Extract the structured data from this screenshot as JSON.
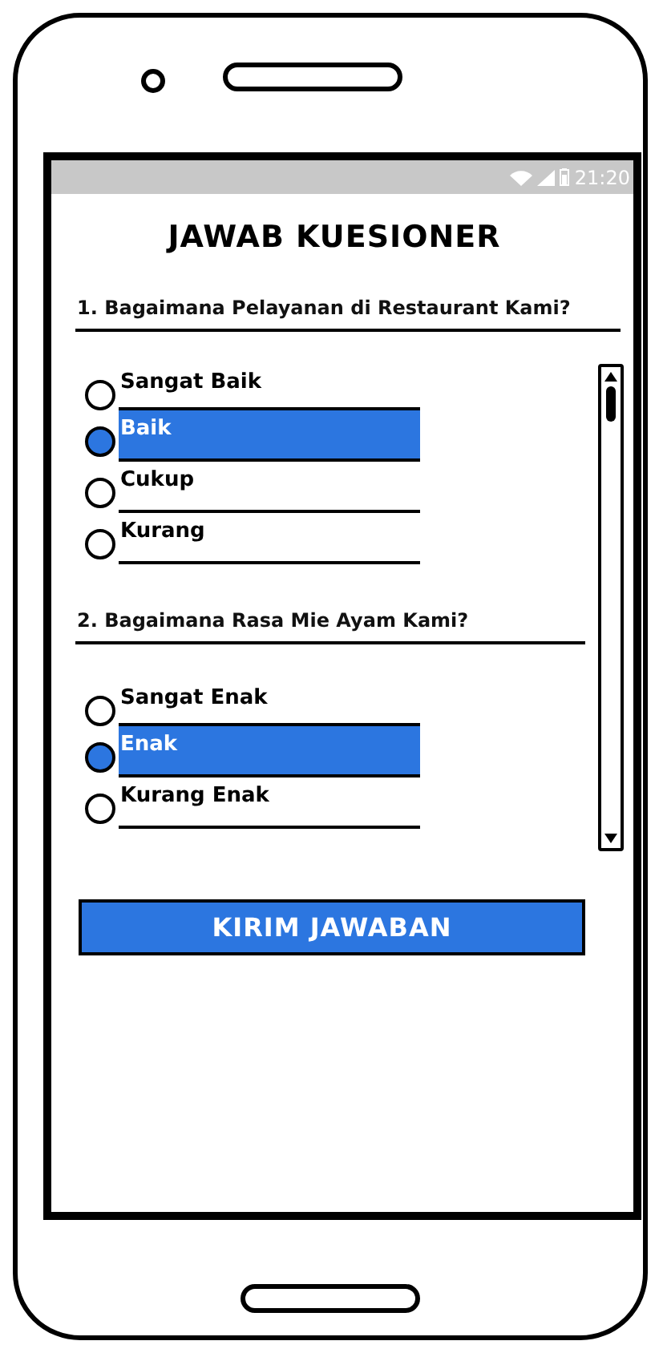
{
  "status_bar": {
    "time": "21:20"
  },
  "title": "JAWAB KUESIONER",
  "questions": [
    {
      "text": "1. Bagaimana Pelayanan di Restaurant Kami?",
      "options": [
        {
          "label": "Sangat Baik",
          "selected": false
        },
        {
          "label": "Baik",
          "selected": true
        },
        {
          "label": "Cukup",
          "selected": false
        },
        {
          "label": "Kurang",
          "selected": false
        }
      ]
    },
    {
      "text": "2. Bagaimana Rasa Mie Ayam Kami?",
      "options": [
        {
          "label": "Sangat Enak",
          "selected": false
        },
        {
          "label": "Enak",
          "selected": true
        },
        {
          "label": "Kurang Enak",
          "selected": false
        }
      ]
    }
  ],
  "submit_button": "KIRIM JAWABAN"
}
